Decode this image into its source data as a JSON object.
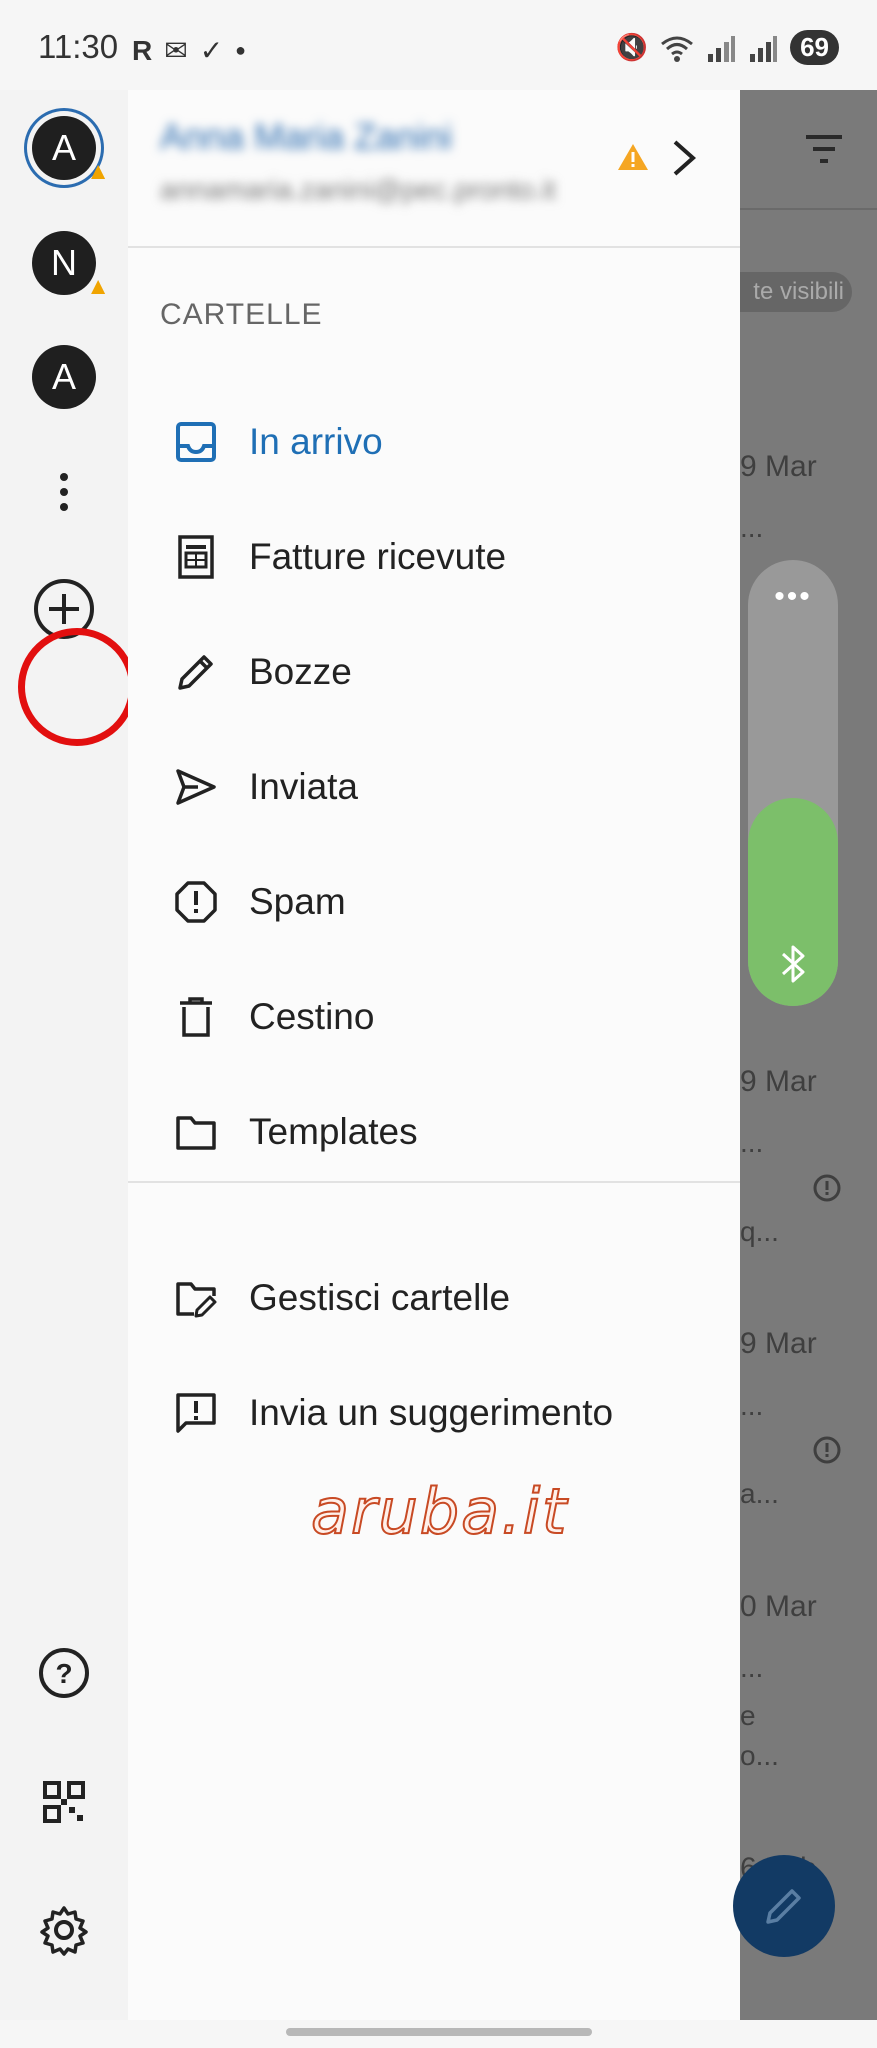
{
  "status_bar": {
    "time": "11:30",
    "left_icons": [
      "R",
      "mail",
      "check-circle",
      "dot"
    ],
    "battery": "69"
  },
  "rail": {
    "accounts": [
      {
        "letter": "A",
        "selected": true,
        "warning": true
      },
      {
        "letter": "N",
        "selected": false,
        "warning": true
      },
      {
        "letter": "A",
        "selected": false,
        "warning": false
      }
    ],
    "more_icon": "more-vertical-icon",
    "add_icon": "add-circle-icon",
    "help_icon": "help-icon",
    "qr_icon": "qr-code-icon",
    "settings_icon": "settings-icon",
    "highlight_color": "#e20f0f"
  },
  "drawer": {
    "account": {
      "name": "Anna Maria Zanini",
      "email": "annamaria.zanini@pec.pronto.it"
    },
    "section_title": "CARTELLE",
    "folders": [
      {
        "label": "In arrivo",
        "icon": "inbox-icon",
        "active": true
      },
      {
        "label": "Fatture ricevute",
        "icon": "invoice-icon",
        "active": false
      },
      {
        "label": "Bozze",
        "icon": "pencil-icon",
        "active": false
      },
      {
        "label": "Inviata",
        "icon": "send-icon",
        "active": false
      },
      {
        "label": "Spam",
        "icon": "spam-icon",
        "active": false
      },
      {
        "label": "Cestino",
        "icon": "trash-icon",
        "active": false
      },
      {
        "label": "Templates",
        "icon": "folder-icon",
        "active": false
      }
    ],
    "actions": [
      {
        "label": "Gestisci cartelle",
        "icon": "folder-edit-icon"
      },
      {
        "label": "Invia un suggerimento",
        "icon": "feedback-icon"
      }
    ],
    "logo": "aruba.it",
    "active_color": "#1f6fb5"
  },
  "background_list": {
    "chip": "te visibili",
    "dates": [
      "9 Mar",
      "9 Mar",
      "9 Mar",
      "0 Mar",
      "6 Feb"
    ],
    "snippets": [
      "...",
      "q...",
      "...",
      "a...",
      "...",
      "e",
      "o..."
    ]
  }
}
